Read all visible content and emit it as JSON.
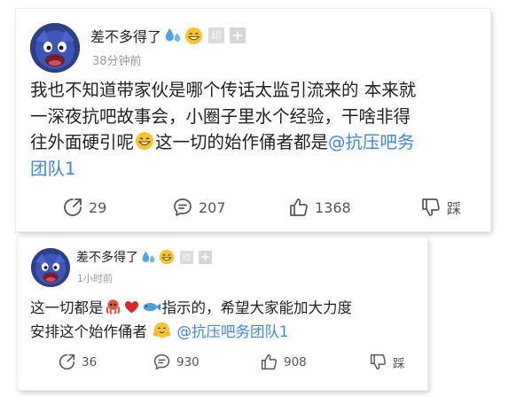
{
  "posts": [
    {
      "username": "差不多得了",
      "name_emojis": [
        "sweat-drops",
        "grinning-face"
      ],
      "tags": [
        "印",
        "+"
      ],
      "time": "38分钟前",
      "lines": [
        "我也不知道带家伙是哪个传话太监引流来的 本来就",
        "一深夜抗吧故事会，小圈子里水个经验，干啥非得",
        "往外面硬引呢",
        "这一切的始作俑者都是",
        "@抗压吧务",
        "团队1"
      ],
      "actions": {
        "share": "29",
        "comment": "207",
        "like": "1368",
        "dislike": "踩"
      }
    },
    {
      "username": "差不多得了",
      "name_emojis": [
        "sweat-drops",
        "grinning-face"
      ],
      "tags": [
        "印",
        "+"
      ],
      "time": "1小时前",
      "lines": [
        "这一切都是",
        "指示的，希望大家能加大力度",
        "安排这个始作俑者",
        "@抗压吧务团队1"
      ],
      "inline_emojis": [
        "octopus",
        "red-heart",
        "fish",
        "smiling-face"
      ],
      "actions": {
        "share": "36",
        "comment": "930",
        "like": "908",
        "dislike": "踩"
      }
    }
  ],
  "colors": {
    "mention": "#3e86d8",
    "meta": "#9a9a9a",
    "avatar_bg": "#2e3f86"
  }
}
